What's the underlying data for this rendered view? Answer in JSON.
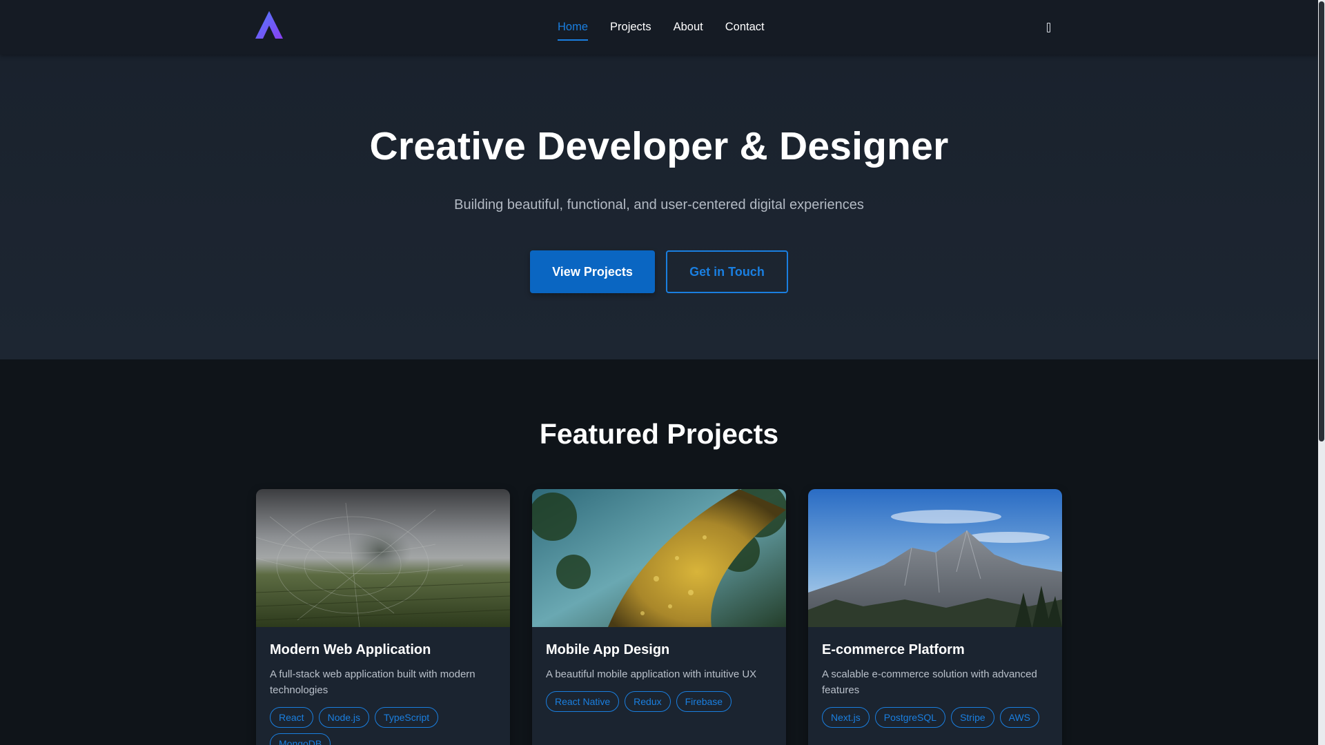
{
  "header": {
    "logo_icon": "logo-a-icon",
    "nav": [
      {
        "label": "Home",
        "active": true
      },
      {
        "label": "Projects",
        "active": false
      },
      {
        "label": "About",
        "active": false
      },
      {
        "label": "Contact",
        "active": false
      }
    ],
    "theme_toggle_icon": "theme-toggle-icon"
  },
  "hero": {
    "title": "Creative Developer & Designer",
    "subtitle": "Building beautiful, functional, and user-centered digital experiences",
    "primary_button": "View Projects",
    "secondary_button": "Get in Touch"
  },
  "projects": {
    "title": "Featured Projects",
    "cards": [
      {
        "title": "Modern Web Application",
        "description": "A full-stack web application built with modern technologies",
        "tags": [
          "React",
          "Node.js",
          "TypeScript",
          "MongoDB"
        ]
      },
      {
        "title": "Mobile App Design",
        "description": "A beautiful mobile application with intuitive UX",
        "tags": [
          "React Native",
          "Redux",
          "Firebase"
        ]
      },
      {
        "title": "E-commerce Platform",
        "description": "A scalable e-commerce solution with advanced features",
        "tags": [
          "Next.js",
          "PostgreSQL",
          "Stripe",
          "AWS"
        ]
      }
    ]
  },
  "colors": {
    "accent": "#1a7fe0",
    "primary_button": "#0a66c2",
    "background": "#0f1419",
    "header": "#151b24",
    "card": "#1b2430"
  }
}
